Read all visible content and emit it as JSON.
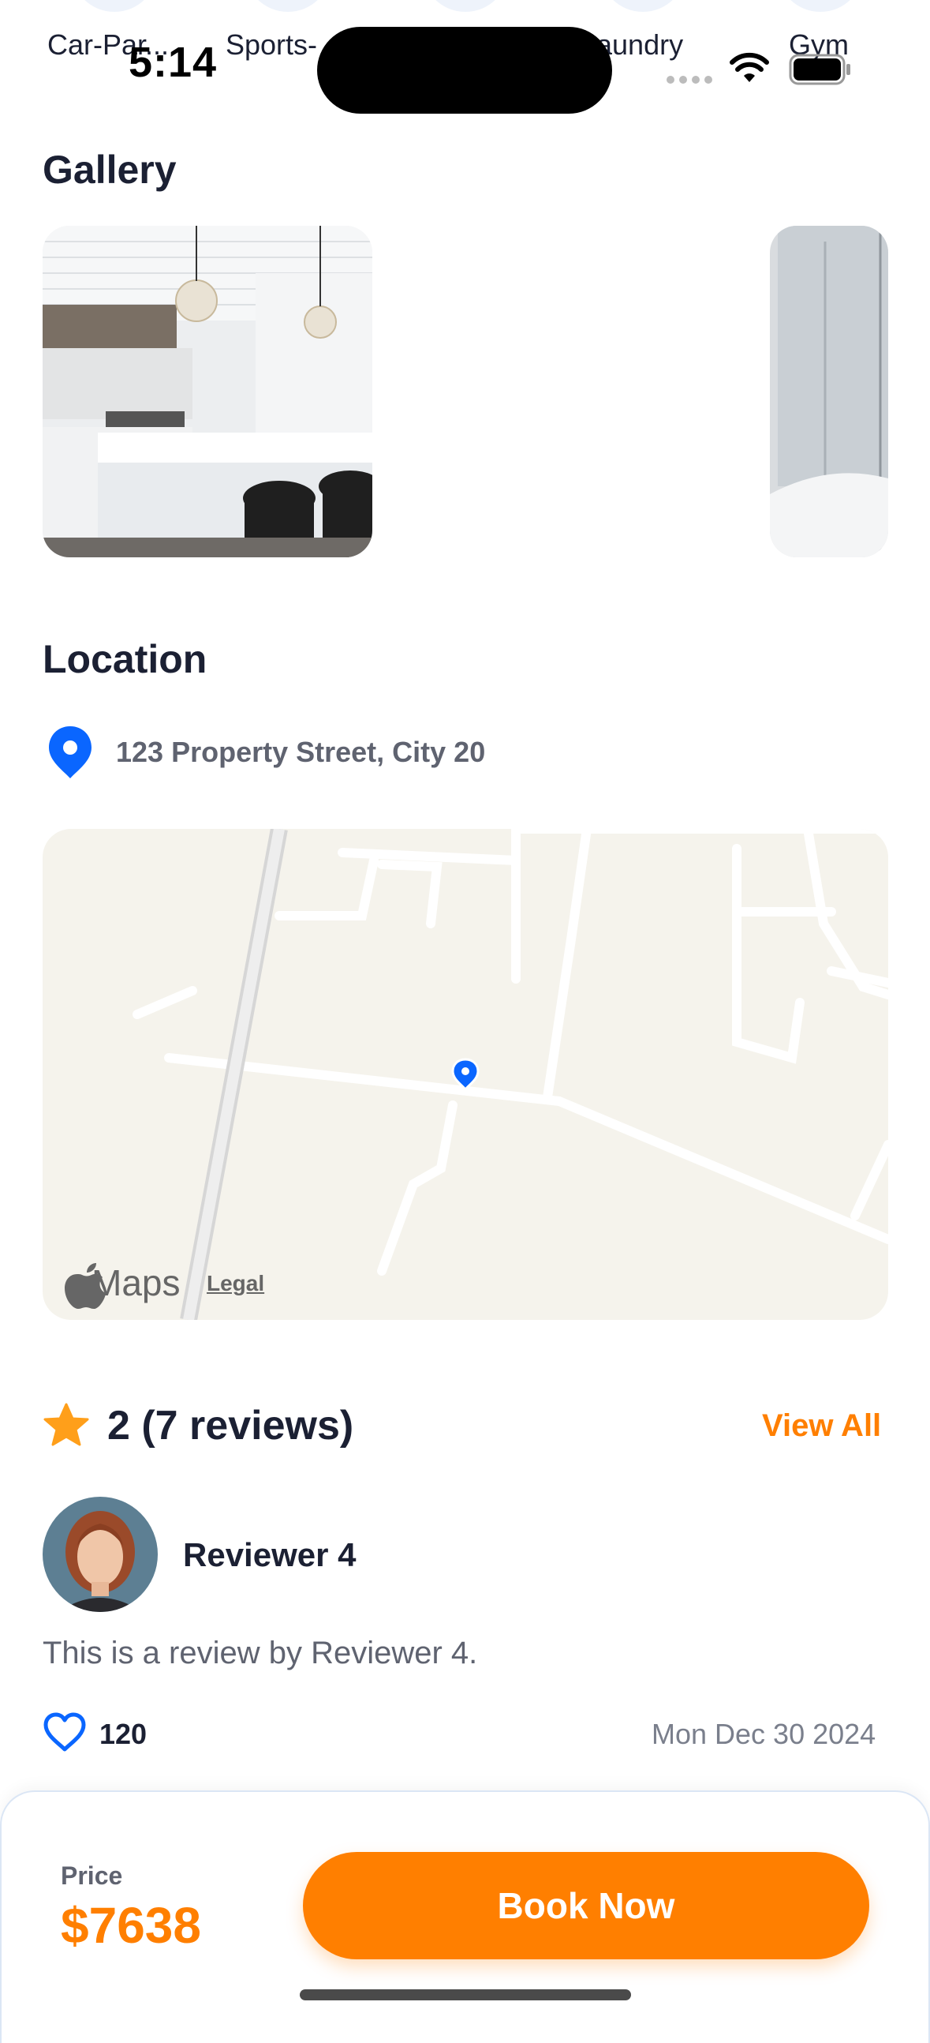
{
  "status_bar": {
    "time": "5:14"
  },
  "amenities": [
    "Car-Par...",
    "Sports-",
    "aundry",
    "Gym"
  ],
  "gallery": {
    "title": "Gallery"
  },
  "location": {
    "title": "Location",
    "address": "123 Property Street, City 20",
    "map_brand": "Maps",
    "map_legal": "Legal"
  },
  "reviews": {
    "summary": "2 (7 reviews)",
    "view_all": "View All",
    "items": [
      {
        "name": "Reviewer 4",
        "text": "This is a review by Reviewer 4.",
        "likes": "120",
        "date": "Mon Dec 30 2024"
      }
    ]
  },
  "booking": {
    "price_label": "Price",
    "price_value": "$7638",
    "book_label": "Book Now"
  },
  "colors": {
    "accent": "#ff7f00",
    "pin": "#0a66ff",
    "text": "#1b2033"
  }
}
